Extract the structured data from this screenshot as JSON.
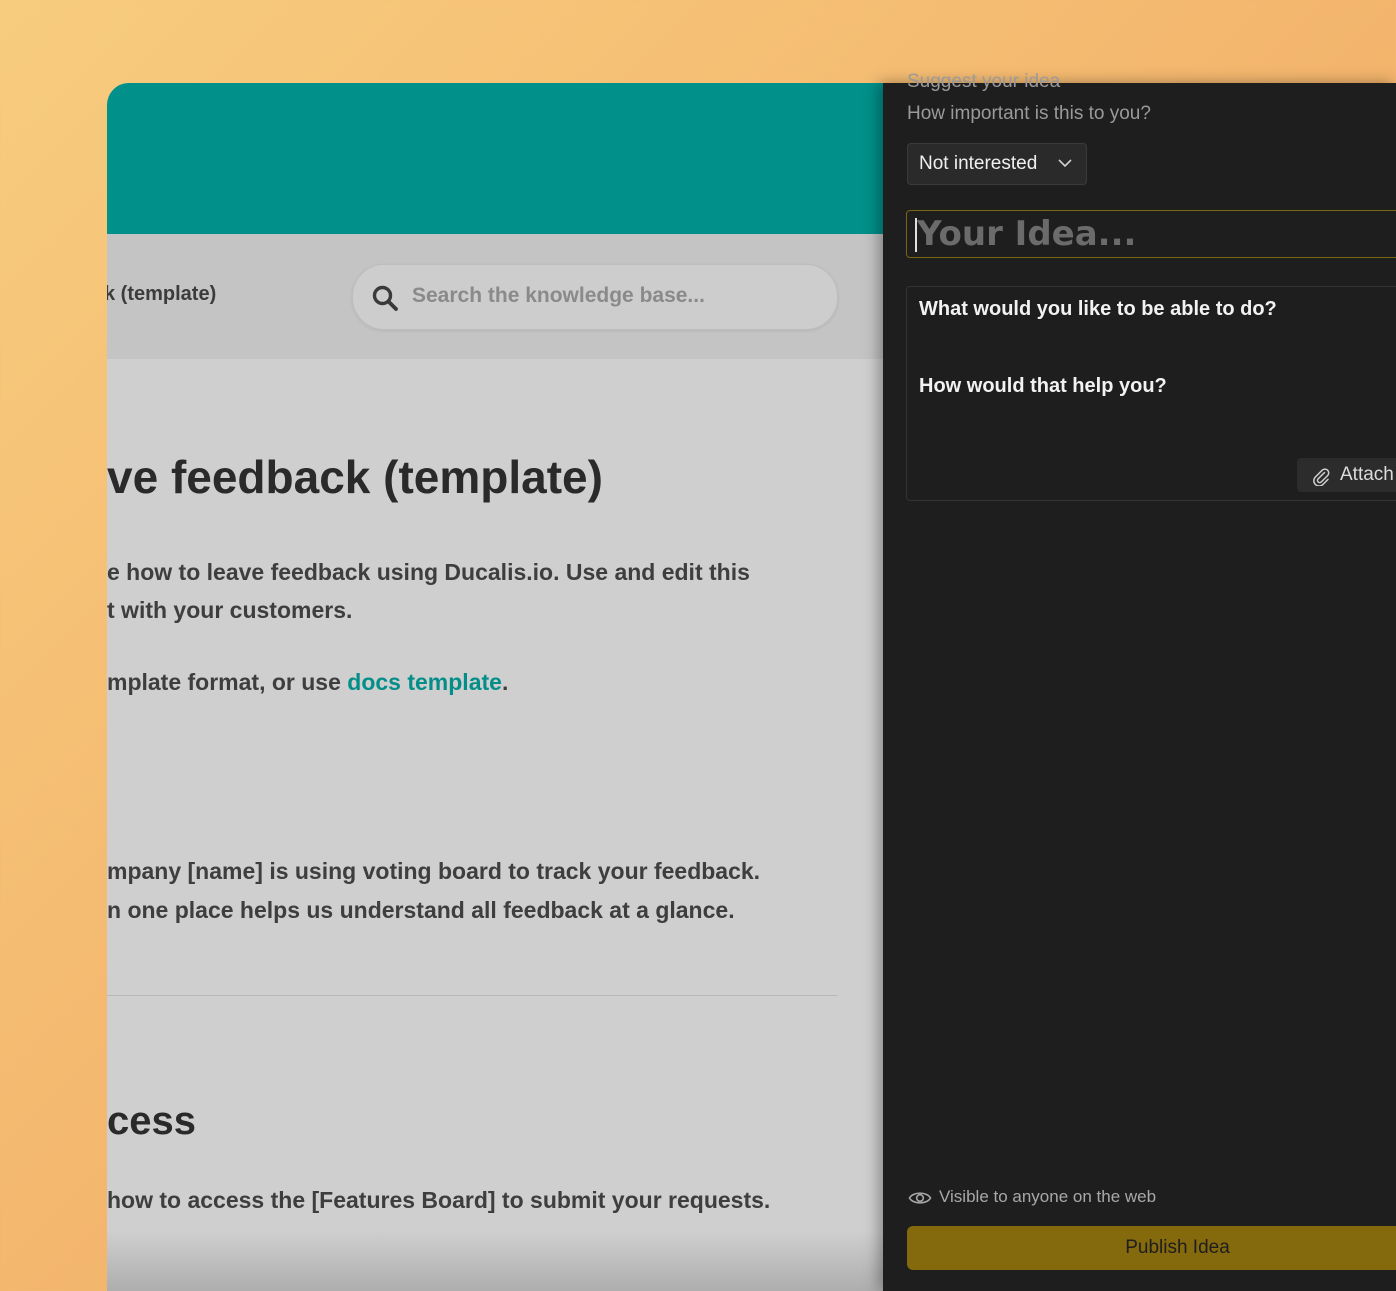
{
  "kb": {
    "breadcrumb": "k (template)",
    "search_placeholder": "Search the knowledge base...",
    "title": "ve feedback (template)",
    "intro_line1": "e how to leave feedback using Ducalis.io. Use and edit this",
    "intro_line2": "t with your customers.",
    "intro_line3_prefix": "mplate format, or use ",
    "intro_link": "docs template",
    "intro_line3_suffix": ".",
    "body_line1": "mpany [name] is using voting board to track your feedback.",
    "body_line2": "n one place helps us understand all feedback at a glance.",
    "section_title": "cess",
    "section_line1": "how to access the [Features Board] to submit your requests."
  },
  "panel": {
    "cut_heading": "Suggest your idea",
    "importance_question": "How important is this to you?",
    "importance_value": "Not interested",
    "idea_placeholder": "Your Idea...",
    "prompt_what": "What would you like to be able to do?",
    "prompt_how": "How would that help you?",
    "attach_label": "Attach",
    "visibility_text": "Visible to anyone on the web",
    "publish_label": "Publish Idea"
  },
  "colors": {
    "teal_header": "#01908a",
    "link": "#048e8a",
    "publish_button": "#85690d",
    "panel_bg": "#1e1e1e"
  }
}
